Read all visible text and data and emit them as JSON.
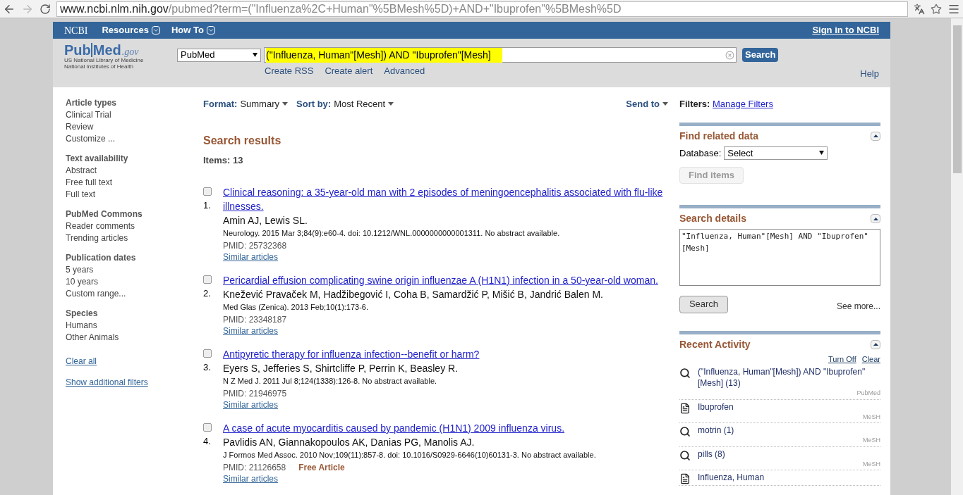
{
  "browser": {
    "url_host": "www.ncbi.nlm.nih.gov",
    "url_path": "/pubmed?term=(\"Influenza%2C+Human\"%5BMesh%5D)+AND+\"Ibuprofen\"%5BMesh%5D"
  },
  "ncbi_bar": {
    "logo": "NCBI",
    "menus": [
      "Resources",
      "How To"
    ],
    "sign_in": "Sign in to NCBI"
  },
  "header": {
    "logo": {
      "part_1": "Pub",
      "part_2": "Med",
      "suffix": ".gov",
      "subtitle": [
        "US National Library of Medicine",
        "National Institutes of Health"
      ]
    },
    "database": "PubMed",
    "query": "(\"Influenza, Human\"[Mesh]) AND \"Ibuprofen\"[Mesh]",
    "search_button": "Search",
    "links": [
      "Create RSS",
      "Create alert",
      "Advanced"
    ],
    "help": "Help"
  },
  "filters_sidebar": {
    "sections": [
      {
        "title": "Article types",
        "items": [
          "Clinical Trial",
          "Review",
          "Customize ..."
        ]
      },
      {
        "title": "Text availability",
        "items": [
          "Abstract",
          "Free full text",
          "Full text"
        ]
      },
      {
        "title": "PubMed Commons",
        "items": [
          "Reader comments",
          "Trending articles"
        ]
      },
      {
        "title": "Publication dates",
        "items": [
          "5 years",
          "10 years",
          "Custom range..."
        ]
      },
      {
        "title": "Species",
        "items": [
          "Humans",
          "Other Animals"
        ]
      }
    ],
    "links": [
      "Clear all",
      "Show additional filters"
    ]
  },
  "toolbar": {
    "format_label": "Format:",
    "format_value": "Summary",
    "sort_label": "Sort by:",
    "sort_value": "Most Recent",
    "send_to": "Send to"
  },
  "results": {
    "title": "Search results",
    "count_label": "Items: 13",
    "items": [
      {
        "number": "1.",
        "checked": false,
        "title": "Clinical reasoning: a 35-year-old man with 2 episodes of meningoencephalitis associated with flu-like illnesses.",
        "authors": "Amin AJ, Lewis SL.",
        "citation": "Neurology. 2015 Mar 3;84(9):e60-4. doi: 10.1212/WNL.0000000000001311. No abstract available.",
        "pmid": "PMID: 25732368",
        "similar": "Similar articles"
      },
      {
        "number": "2.",
        "checked": false,
        "title": "Pericardial effusion complicating swine origin influenzae A (H1N1) infection in a 50-year-old woman.",
        "authors": "Knežević Pravaček M, Hadžibegović I, Coha B, Samardžić P, Mišić B, Jandrić Balen M.",
        "citation": "Med Glas (Zenica). 2013 Feb;10(1):173-6.",
        "pmid": "PMID: 23348187",
        "similar": "Similar articles"
      },
      {
        "number": "3.",
        "checked": false,
        "title": "Antipyretic therapy for influenza infection--benefit or harm?",
        "authors": "Eyers S, Jefferies S, Shirtcliffe P, Perrin K, Beasley R.",
        "citation": "N Z Med J. 2011 Jul 8;124(1338):126-8. No abstract available.",
        "pmid": "PMID: 21946975",
        "similar": "Similar articles"
      },
      {
        "number": "4.",
        "checked": false,
        "title": "A case of acute myocarditis caused by pandemic (H1N1) 2009 influenza virus.",
        "authors": "Pavlidis AN, Giannakopoulos AK, Danias PG, Manolis AJ.",
        "citation": "J Formos Med Assoc. 2010 Nov;109(11):857-8. doi: 10.1016/S0929-6646(10)60131-3. No abstract available.",
        "pmid": "PMID: 21126658",
        "free": "Free Article",
        "similar": "Similar articles"
      }
    ]
  },
  "right_panel": {
    "filters_label": "Filters:",
    "manage_filters": "Manage Filters",
    "find_related": {
      "title": "Find related data",
      "database_label": "Database:",
      "database_value": "Select",
      "button": "Find items",
      "button_disabled": true
    },
    "search_details": {
      "title": "Search details",
      "query": "\"Influenza, Human\"[Mesh] AND \"Ibuprofen\"[Mesh]",
      "button": "Search",
      "see_more": "See more..."
    },
    "recent_activity": {
      "title": "Recent Activity",
      "actions": [
        "Turn Off",
        "Clear"
      ],
      "items": [
        {
          "kind": "search",
          "text": "(\"Influenza, Human\"[Mesh]) AND \"Ibuprofen\"[Mesh] (13)",
          "source": "PubMed"
        },
        {
          "kind": "record",
          "text": "Ibuprofen",
          "source": "MeSH"
        },
        {
          "kind": "search",
          "text": "motrin (1)",
          "source": "MeSH"
        },
        {
          "kind": "search",
          "text": "pills (8)",
          "source": "MeSH"
        },
        {
          "kind": "record",
          "text": "Influenza, Human"
        }
      ]
    }
  }
}
